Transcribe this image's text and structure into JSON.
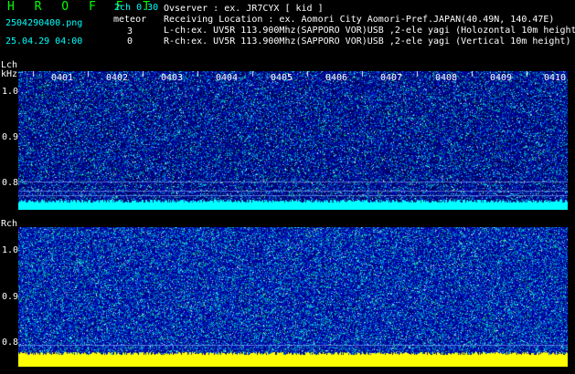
{
  "header": {
    "app_title": "H R O F F T",
    "version": "2ch 0.30",
    "filename": "2504290400.png",
    "mode_label": "meteor",
    "timestamp": "25.04.29 04:00",
    "lch_count": "3",
    "rch_count": "0",
    "observer": "Ovserver           : ex. JR7CYX [ kid ]",
    "location": "Receiving Location : ex. Aomori City Aomori-Pref.JAPAN(40.49N, 140.47E)",
    "lch_info": "L-ch:ex. UV5R 113.900Mhz(SAPPORO VOR)USB ,2-ele yagi (Holozontal 10m height",
    "rch_info": "R-ch:ex. UV5R 113.900Mhz(SAPPORO VOR)USB ,2-ele yagi (Vertical 10m height)"
  },
  "lch_panel": {
    "label": "Lch",
    "unit": "kHz",
    "yticks": [
      "1.0",
      "0.9",
      "0.8"
    ],
    "time_ticks": [
      "0401",
      "0402",
      "0403",
      "0404",
      "0405",
      "0406",
      "0407",
      "0408",
      "0409",
      "0410"
    ]
  },
  "rch_panel": {
    "label": "Rch",
    "yticks": [
      "1.0",
      "0.9",
      "0.8"
    ]
  },
  "colors": {
    "background": "#000000",
    "title": "#00ff00",
    "cyan": "#00ffff",
    "yellow": "#ffff00",
    "text": "#ffffff"
  }
}
